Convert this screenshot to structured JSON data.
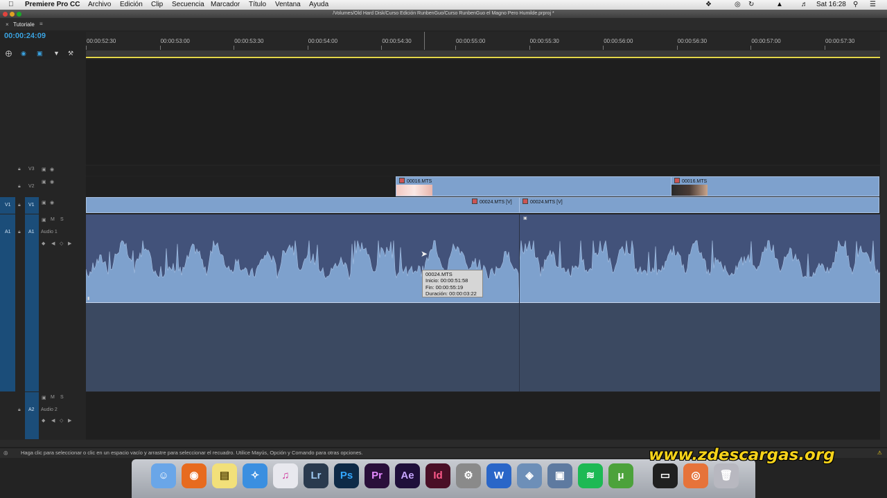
{
  "menubar": {
    "items": [
      "Premiere Pro CC",
      "Archivo",
      "Edición",
      "Clip",
      "Secuencia",
      "Marcador",
      "Título",
      "Ventana",
      "Ayuda"
    ],
    "clock": "Sat 16:28"
  },
  "window": {
    "title": "/Volumes/Old Hard Disk/Curso Edición RunbenGuo/Curso RunbenGuo el Magno Pero Humilde.prproj *"
  },
  "panel": {
    "tab_label": "Tutoriale",
    "timecode": "00:00:24:09"
  },
  "ruler": {
    "ticks": [
      "00:00:52:30",
      "00:00:53:00",
      "00:00:53:30",
      "00:00:54:00",
      "00:00:54:30",
      "00:00:55:00",
      "00:00:55:30",
      "00:00:56:00",
      "00:00:56:30",
      "00:00:57:00",
      "00:00:57:30"
    ]
  },
  "tracks": {
    "v3": {
      "label": "V3"
    },
    "v2": {
      "label": "V2"
    },
    "v1": {
      "source": "V1",
      "label": "V1"
    },
    "a1": {
      "source": "A1",
      "label": "A1",
      "name": "Audio 1",
      "m": "M",
      "s": "S"
    },
    "a2": {
      "label": "A2",
      "name": "Audio 2",
      "m": "M",
      "s": "S"
    }
  },
  "clips": {
    "v2_a": "00016.MTS",
    "v2_b": "00016.MTS",
    "v1_a": "00024.MTS [V]",
    "v1_b": "00024.MTS [V]"
  },
  "tooltip": {
    "name": "00024.MTS",
    "start": "Inicio: 00:00:51:58",
    "end": "Fin: 00:00:55:19",
    "duration": "Duración: 00:00:03:22"
  },
  "status": {
    "text": "Haga clic para seleccionar o clic en un espacio vacío y arrastre para seleccionar el recuadro. Utilice Mayús, Opción y Comando para otras opciones."
  },
  "dock": {
    "apps": [
      "Finder",
      "Firefox",
      "Stickies",
      "Safari",
      "iTunes",
      "Lr",
      "Ps",
      "Pr",
      "Ae",
      "Id",
      "System Preferences",
      "Word",
      "Preview",
      "Photo Booth",
      "Spotify",
      "uTorrent",
      "Display",
      "Photo",
      "Trash"
    ]
  },
  "watermark": "www.zdescargas.org",
  "colors": {
    "accent": "#3aa2e0",
    "clip": "#7ea1cd",
    "workarea": "#e5d84a",
    "waveform": "#7ea1cd"
  }
}
